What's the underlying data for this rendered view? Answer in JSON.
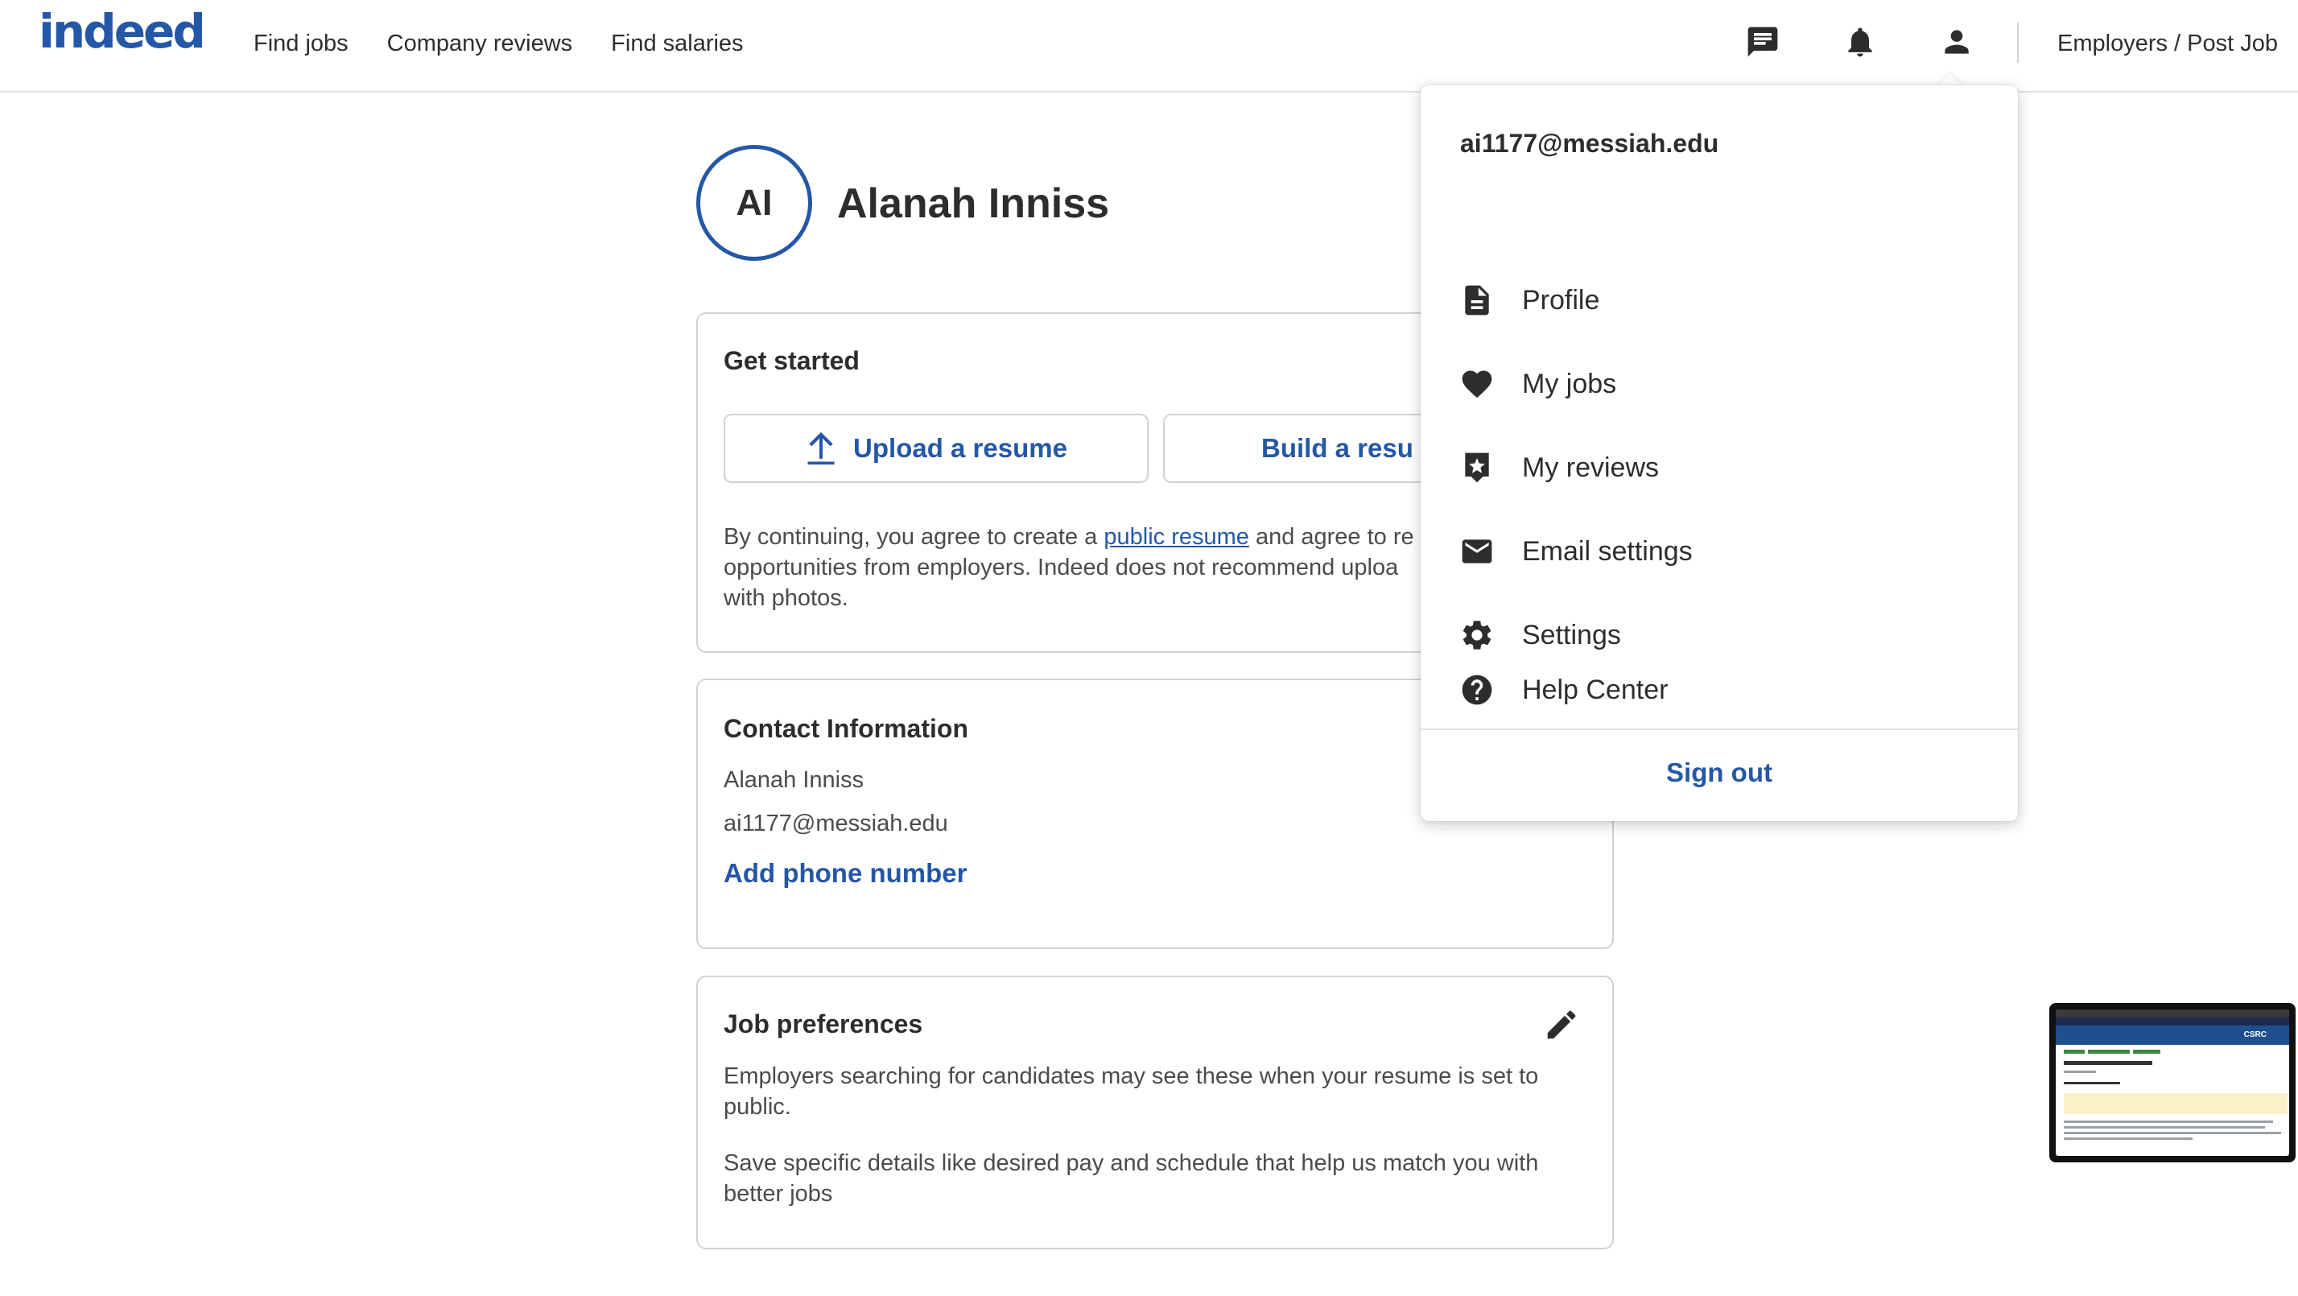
{
  "header": {
    "logo": "indeed",
    "nav": [
      "Find jobs",
      "Company reviews",
      "Find salaries"
    ],
    "icons": [
      "messages-icon",
      "notifications-bell-icon",
      "account-person-icon"
    ],
    "employers_link": "Employers / Post Job"
  },
  "profile": {
    "initials": "AI",
    "name": "Alanah Inniss"
  },
  "get_started": {
    "title": "Get started",
    "upload_label": "Upload a resume",
    "build_label": "Build a resu",
    "consent_prefix": "By continuing, you agree to create a ",
    "consent_link": "public resume",
    "consent_suffix": " and agree to re",
    "consent_line2": "opportunities from employers. Indeed does not recommend uploa",
    "consent_line3": "with photos."
  },
  "contact": {
    "title": "Contact Information",
    "name": "Alanah Inniss",
    "email": "ai1177@messiah.edu",
    "add_phone": "Add phone number"
  },
  "preferences": {
    "title": "Job preferences",
    "text1": "Employers searching for candidates may see these when your resume is set to public.",
    "text2": "Save specific details like desired pay and schedule that help us match you with better jobs"
  },
  "menu": {
    "email": "ai1177@messiah.edu",
    "items": [
      {
        "label": "Profile",
        "icon": "document-icon"
      },
      {
        "label": "My jobs",
        "icon": "heart-icon"
      },
      {
        "label": "My reviews",
        "icon": "star-badge-icon"
      },
      {
        "label": "Email settings",
        "icon": "envelope-icon"
      },
      {
        "label": "Settings",
        "icon": "gear-icon"
      },
      {
        "label": "Help Center",
        "icon": "help-circle-icon"
      }
    ],
    "sign_out": "Sign out"
  },
  "thumbnail": {
    "banner": "CSRC"
  },
  "colors": {
    "brand_blue": "#2557a7",
    "text": "#2d2d2d",
    "border": "#d4d2d0"
  }
}
